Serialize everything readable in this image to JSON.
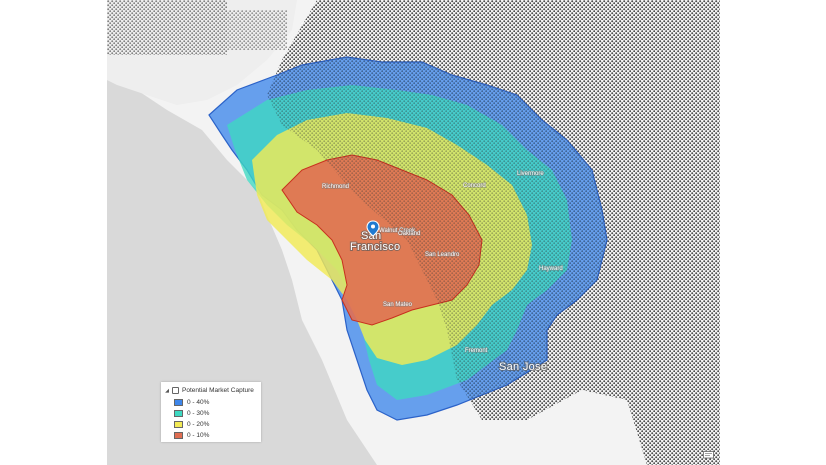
{
  "map": {
    "colors": {
      "water": "#d9d9d9",
      "land": "#f3f3f3",
      "urban_dots": "#3a3a3a",
      "ring_40": "#3e86ea",
      "ring_30": "#3dd9c2",
      "ring_20": "#f2ea55",
      "ring_10": "#e06e52",
      "ring_40_outline": "#2b62c8",
      "ring_10_outline": "#c8301e",
      "marker": "#1f7ad1"
    },
    "labels": {
      "san_francisco_line1": "San",
      "san_francisco_line2": "Francisco",
      "san_jose": "San Jose",
      "concord": "Concord",
      "richmond": "Richmond",
      "oakland": "Oakland",
      "hayward": "Hayward",
      "fremont": "Fremont",
      "san_leandro": "San Leandro",
      "san_mateo": "San Mateo",
      "walnut_creek": "Walnut Creek",
      "livermore": "Livermore"
    },
    "marker_icon": "map-pin-icon"
  },
  "legend": {
    "title": "Potential Market Capture",
    "toggle_glyph": "◢",
    "items": [
      {
        "label": "0 - 40%",
        "color": "#3e86ea"
      },
      {
        "label": "0 - 30%",
        "color": "#3dd9c2"
      },
      {
        "label": "0 - 20%",
        "color": "#f2ea55"
      },
      {
        "label": "0 - 10%",
        "color": "#e06e52"
      }
    ]
  },
  "corner_icon": "feedback-icon"
}
